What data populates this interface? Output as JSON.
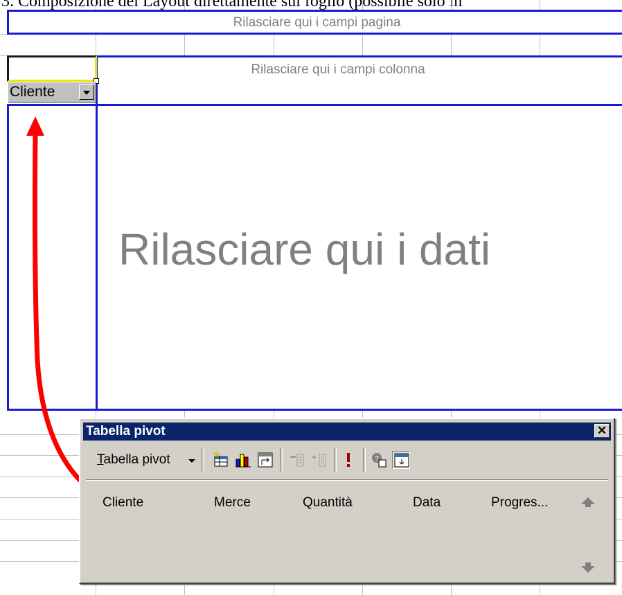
{
  "document": {
    "caption": "3.  Composizione del Layout direttamente sul foglio (possibile solo in"
  },
  "sheet": {
    "page_fields_drop": "Rilasciare qui i campi pagina",
    "column_fields_drop": "Rilasciare qui i campi colonna",
    "data_drop": "Rilasciare qui i dati",
    "row_field_button": "Cliente"
  },
  "pivot_toolbar": {
    "title": "Tabella pivot",
    "close_label": "✕",
    "menu_label": "Tabella pivot",
    "menu_mnemonic": "T",
    "menu_rest": "abella pivot",
    "fields": [
      "Cliente",
      "Merce",
      "Quantità",
      "Data",
      "Progres..."
    ],
    "buttons": [
      "format-report-icon",
      "chart-wizard-icon",
      "pivot-wizard-icon",
      "hide-detail-icon",
      "show-detail-icon",
      "refresh-data-icon",
      "field-settings-icon",
      "display-fields-icon"
    ]
  },
  "colors": {
    "drop_zone_border": "#1a1ad4",
    "title_bar": "#0a246a",
    "drag_arrow": "#ff0000"
  }
}
